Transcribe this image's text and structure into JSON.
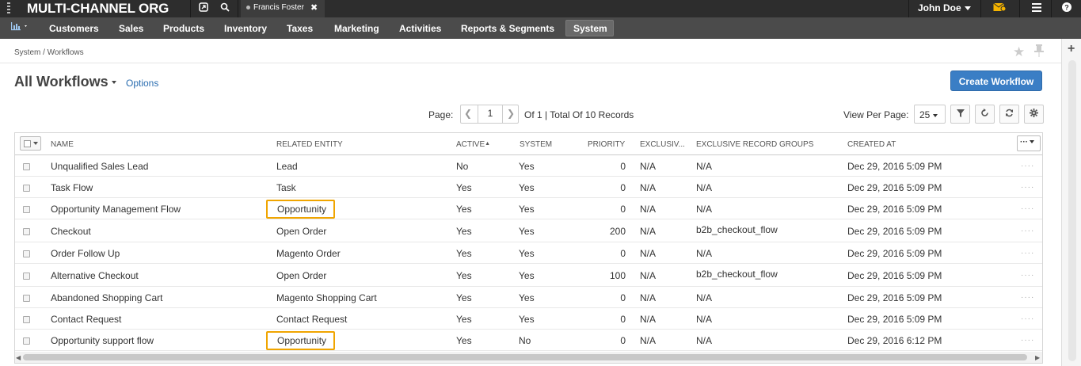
{
  "topbar": {
    "org_name": "MULTI-CHANNEL ORG",
    "open_tab": "Francis Foster",
    "tab_close": "✖",
    "user_name": "John Doe"
  },
  "nav": {
    "items": [
      "Customers",
      "Sales",
      "Products",
      "Inventory",
      "Taxes",
      "Marketing",
      "Activities",
      "Reports & Segments",
      "System"
    ],
    "active": "System"
  },
  "breadcrumb": "System / Workflows",
  "page": {
    "title": "All Workflows",
    "options_label": "Options",
    "create_button": "Create Workflow"
  },
  "pager": {
    "page_label": "Page:",
    "current_page": "1",
    "info": "Of 1 | Total Of 10 Records",
    "view_per_page_label": "View Per Page:",
    "view_per_page_value": "25"
  },
  "table": {
    "columns": {
      "name": "NAME",
      "related_entity": "RELATED ENTITY",
      "active": "ACTIVE",
      "system": "SYSTEM",
      "priority": "PRIORITY",
      "exclusive": "EXCLUSIV...",
      "exclusive_groups": "EXCLUSIVE RECORD GROUPS",
      "created_at": "CREATED AT"
    },
    "rows": [
      {
        "name": "Unqualified Sales Lead",
        "entity": "Lead",
        "active": "No",
        "system": "Yes",
        "priority": "0",
        "exclusive": "N/A",
        "groups": "N/A",
        "created": "Dec 29, 2016 5:09 PM"
      },
      {
        "name": "Task Flow",
        "entity": "Task",
        "active": "Yes",
        "system": "Yes",
        "priority": "0",
        "exclusive": "N/A",
        "groups": "N/A",
        "created": "Dec 29, 2016 5:09 PM"
      },
      {
        "name": "Opportunity Management Flow",
        "entity": "Opportunity",
        "active": "Yes",
        "system": "Yes",
        "priority": "0",
        "exclusive": "N/A",
        "groups": "N/A",
        "created": "Dec 29, 2016 5:09 PM"
      },
      {
        "name": "Checkout",
        "entity": "Open Order",
        "active": "Yes",
        "system": "Yes",
        "priority": "200",
        "exclusive": "N/A",
        "groups": "b2b_checkout_flow",
        "created": "Dec 29, 2016 5:09 PM"
      },
      {
        "name": "Order Follow Up",
        "entity": "Magento Order",
        "active": "Yes",
        "system": "Yes",
        "priority": "0",
        "exclusive": "N/A",
        "groups": "N/A",
        "created": "Dec 29, 2016 5:09 PM"
      },
      {
        "name": "Alternative Checkout",
        "entity": "Open Order",
        "active": "Yes",
        "system": "Yes",
        "priority": "100",
        "exclusive": "N/A",
        "groups": "b2b_checkout_flow",
        "created": "Dec 29, 2016 5:09 PM"
      },
      {
        "name": "Abandoned Shopping Cart",
        "entity": "Magento Shopping Cart",
        "active": "Yes",
        "system": "Yes",
        "priority": "0",
        "exclusive": "N/A",
        "groups": "N/A",
        "created": "Dec 29, 2016 5:09 PM"
      },
      {
        "name": "Contact Request",
        "entity": "Contact Request",
        "active": "Yes",
        "system": "Yes",
        "priority": "0",
        "exclusive": "N/A",
        "groups": "N/A",
        "created": "Dec 29, 2016 5:09 PM"
      },
      {
        "name": "Opportunity support flow",
        "entity": "Opportunity",
        "active": "Yes",
        "system": "No",
        "priority": "0",
        "exclusive": "N/A",
        "groups": "N/A",
        "created": "Dec 29, 2016 6:12 PM"
      }
    ],
    "highlighted_entity": "Opportunity"
  },
  "colors": {
    "topbar": "#2d2d2d",
    "navbar": "#4b4b4b",
    "primary_button": "#3a7ec5",
    "highlight": "#f0a500",
    "link": "#2a6db0"
  }
}
